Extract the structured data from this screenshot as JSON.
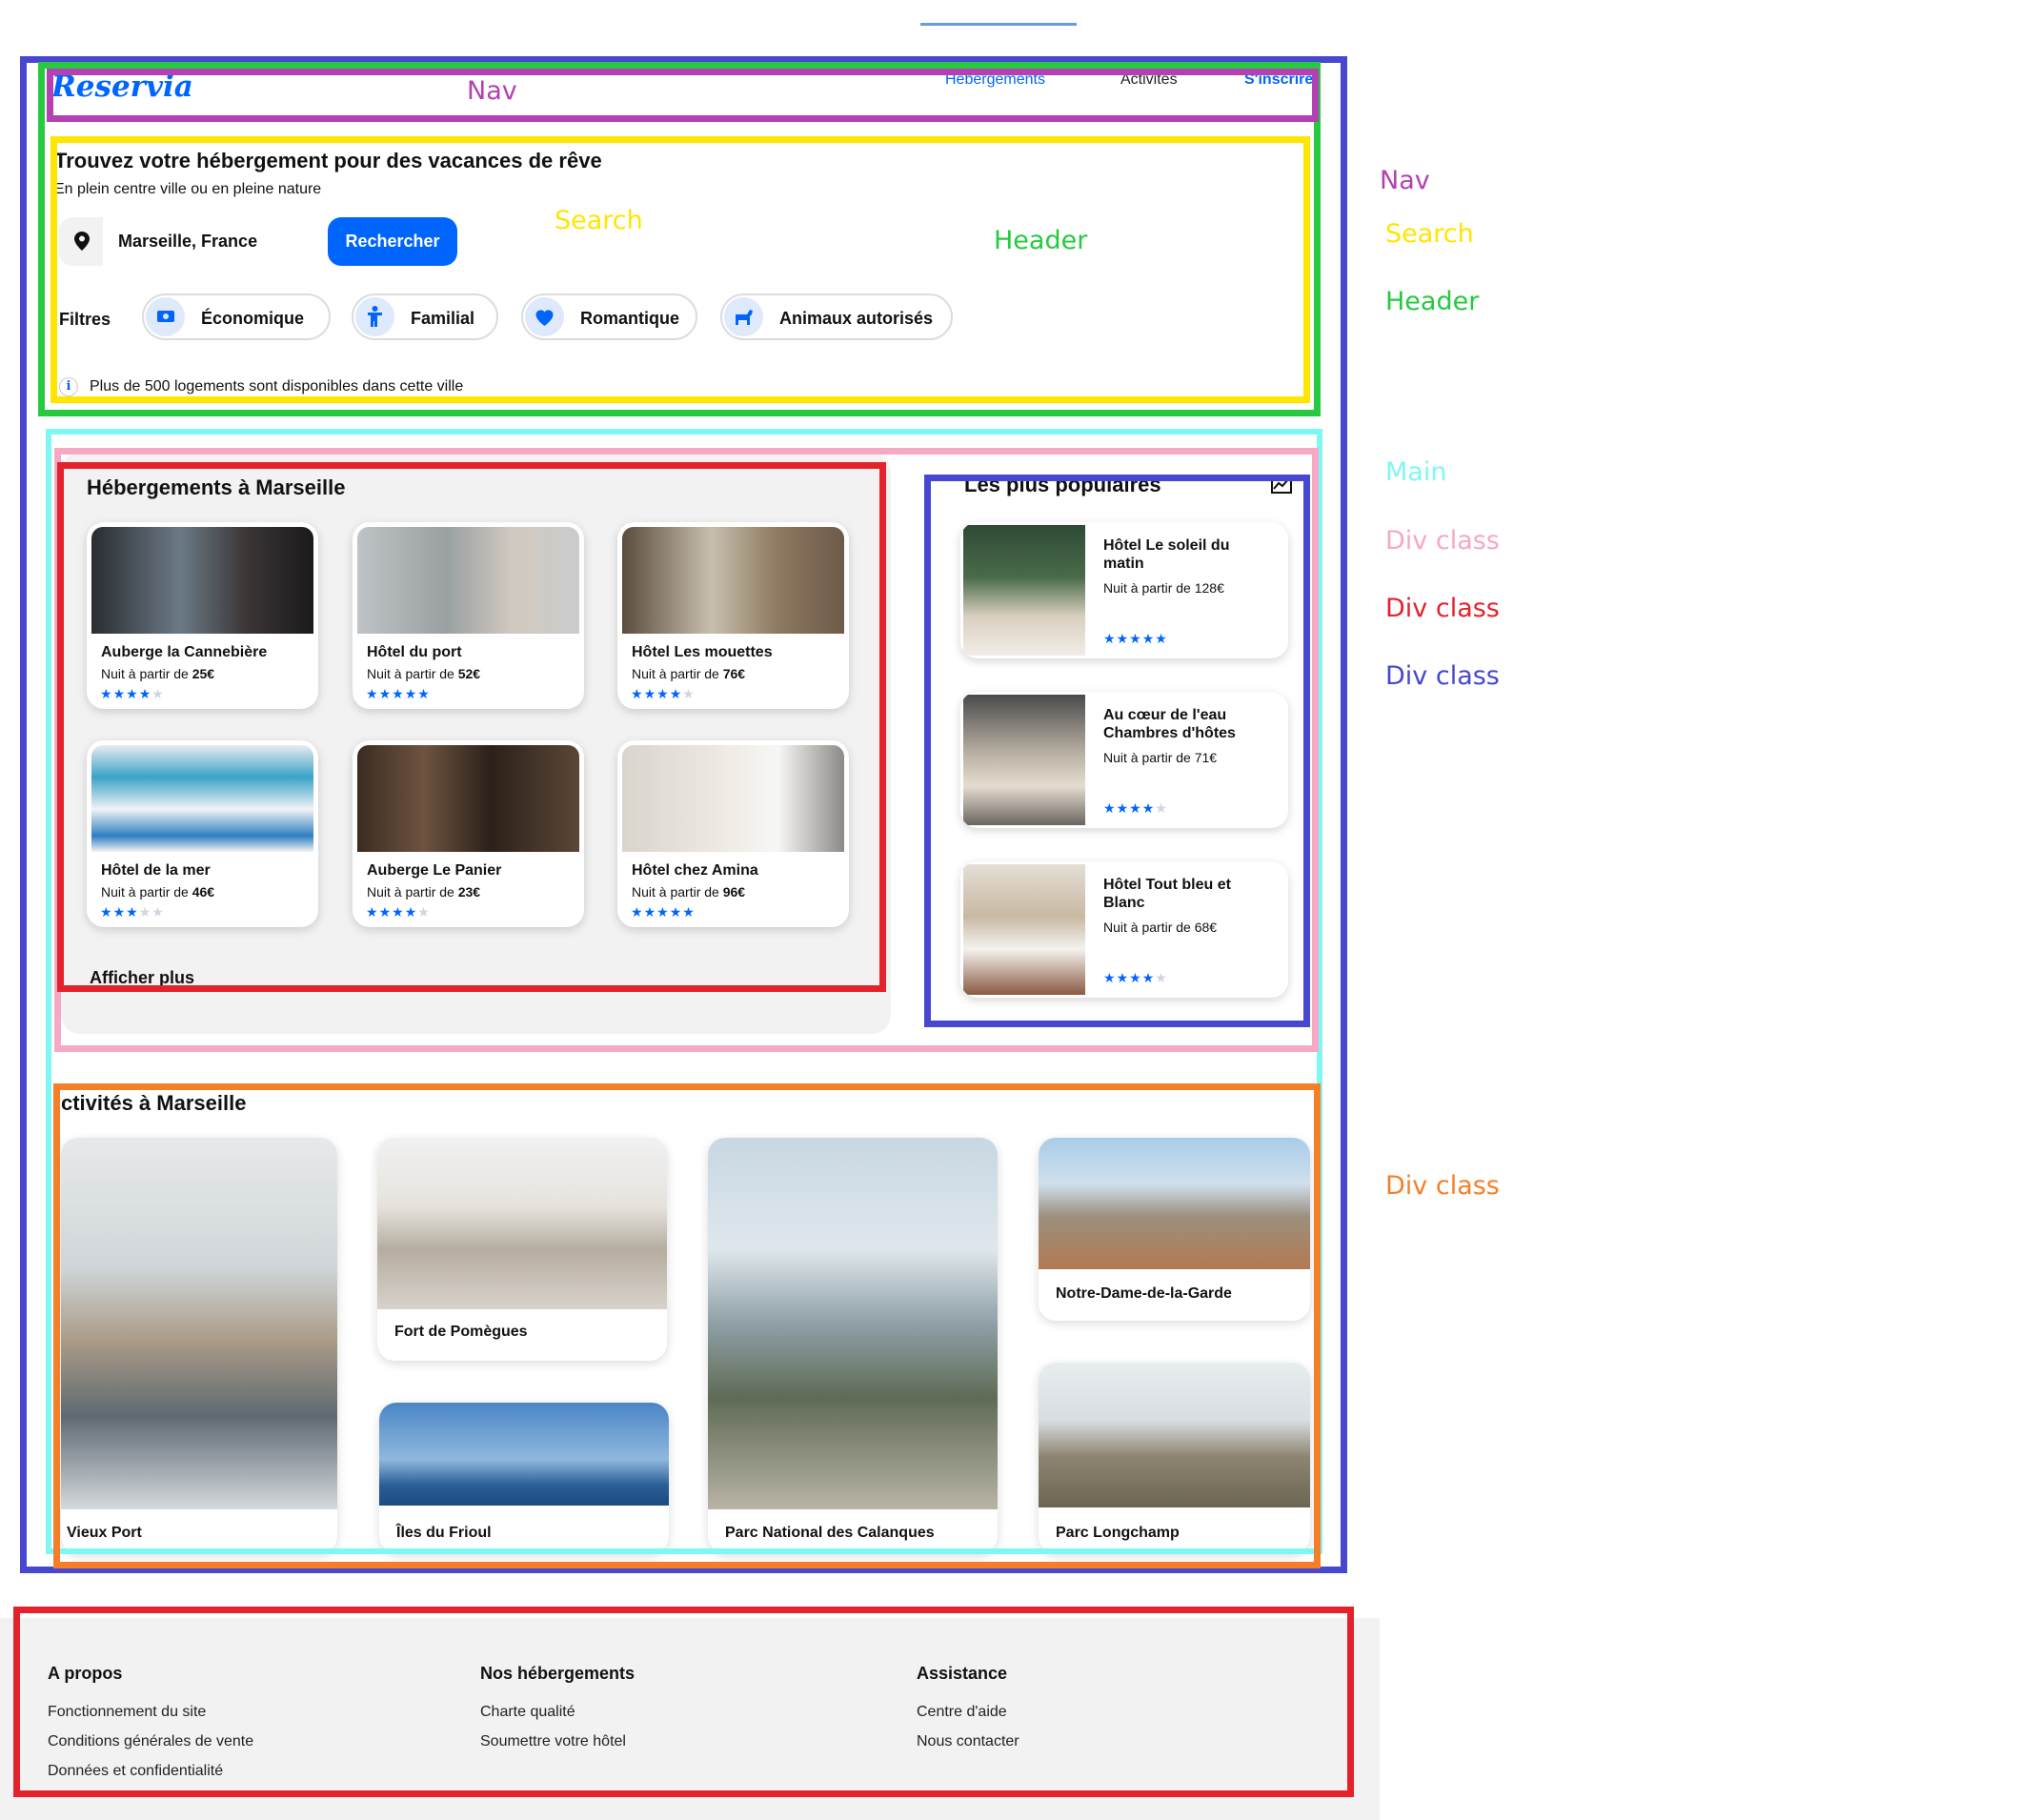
{
  "nav": {
    "logo": "Reservia",
    "links": [
      "Hébergements",
      "Activités"
    ],
    "signup": "S'inscrire"
  },
  "hero": {
    "title": "Trouvez votre hébergement pour des vacances de rêve",
    "subtitle": "En plein centre ville ou en pleine nature",
    "search_value": "Marseille, France",
    "search_button": "Rechercher",
    "filters_label": "Filtres",
    "filters": [
      "Économique",
      "Familial",
      "Romantique",
      "Animaux autorisés"
    ],
    "info": "Plus de 500 logements sont disponibles dans cette ville"
  },
  "hebergements": {
    "title": "Hébergements à Marseille",
    "price_prefix": "Nuit à partir de",
    "cards": [
      {
        "name": "Auberge la Cannebière",
        "price": "25€",
        "rating": 4
      },
      {
        "name": "Hôtel du port",
        "price": "52€",
        "rating": 5
      },
      {
        "name": "Hôtel Les mouettes",
        "price": "76€",
        "rating": 4
      },
      {
        "name": "Hôtel de la mer",
        "price": "46€",
        "rating": 3
      },
      {
        "name": "Auberge Le Panier",
        "price": "23€",
        "rating": 4
      },
      {
        "name": "Hôtel chez Amina",
        "price": "96€",
        "rating": 5
      }
    ],
    "more": "Afficher plus"
  },
  "populaires": {
    "title": "Les plus populaires",
    "icon": "trending-up-icon",
    "cards": [
      {
        "name": "Hôtel Le soleil du matin",
        "price": "Nuit à partir de 128€",
        "rating": 5
      },
      {
        "name": "Au cœur de l'eau Chambres d'hôtes",
        "price": "Nuit à partir de 71€",
        "rating": 4
      },
      {
        "name": "Hôtel Tout bleu et Blanc",
        "price": "Nuit à partir de 68€",
        "rating": 4
      }
    ]
  },
  "activites": {
    "title": "ctivités à Marseille",
    "cards": [
      "Vieux Port",
      "Fort de Pomègues",
      "Îles du Frioul",
      "Parc National des Calanques",
      "Notre-Dame-de-la-Garde",
      "Parc Longchamp"
    ]
  },
  "footer": {
    "columns": [
      {
        "title": "A propos",
        "links": [
          "Fonctionnement du site",
          "Conditions générales de vente",
          "Données et confidentialité"
        ]
      },
      {
        "title": "Nos hébergements",
        "links": [
          "Charte qualité",
          "Soumettre votre hôtel"
        ]
      },
      {
        "title": "Assistance",
        "links": [
          "Centre d'aide",
          "Nous contacter"
        ]
      }
    ]
  },
  "annotations": {
    "nav": "Nav",
    "search": "Search",
    "header": "Header",
    "main": "Main",
    "div_class": "Div class",
    "colors": {
      "purple": "#b440b4",
      "yellow": "#ffe600",
      "green": "#26c940",
      "cyan": "#7ff7f2",
      "pink": "#f5a9c4",
      "red": "#e3222c",
      "blue": "#4747cf",
      "orange": "#f57f29"
    }
  },
  "colors": {
    "accent": "#0065fc",
    "footer_bg": "#f2f2f2",
    "section_bg": "#f2f2f2"
  }
}
